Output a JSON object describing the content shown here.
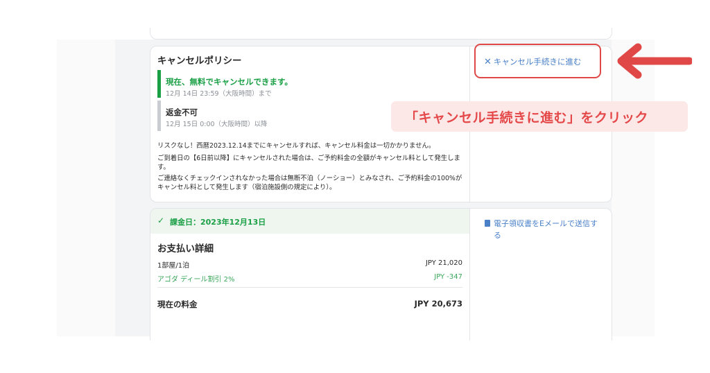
{
  "cancellation_policy": {
    "title": "キャンセルポリシー",
    "free_cancel_title": "現在、無料でキャンセルできます。",
    "free_cancel_until": "12月 14日 23:59（大阪時間）まで",
    "nonrefundable_title": "返金不可",
    "nonrefundable_from": "12月 15日 0:00（大阪時間）以降",
    "paragraph_1": "リスクなし！西暦2023.12.14までにキャンセルすれば、キャンセル料金は一切かかりません。",
    "paragraph_2": "ご到着日の【6日前以降】にキャンセルされた場合は、ご予約料金の全額がキャンセル料として発生します。",
    "paragraph_3": "ご連絡なくチェックインされなかった場合は無断不泊（ノーショー）とみなされ、ご予約料金の100%がキャンセル料として発生します（宿泊施設側の規定により）。",
    "cancel_link_icon": "close-icon",
    "cancel_link": "キャンセル手続きに進む"
  },
  "annotation": {
    "callout_text": "「キャンセル手続きに進む」をクリック",
    "highlight_color": "#e04848",
    "arrow_icon": "left-arrow-icon"
  },
  "payment": {
    "charge_icon": "check-icon",
    "charge_date": "課金日：2023年12月13日",
    "title": "お支払い詳細",
    "rows": [
      {
        "label": "1部屋/1泊",
        "amount": "JPY 21,020"
      },
      {
        "label": "アゴダ ディール割引 2%",
        "amount": "JPY -347"
      }
    ],
    "total_label": "現在の料金",
    "total_amount": "JPY 20,673",
    "receipt_icon": "document-icon",
    "receipt_link": "電子領収書をEメールで送信する"
  },
  "colors": {
    "green": "#1a9f45",
    "link_blue": "#4a80c8",
    "callout_bg": "#fde8e8",
    "callout_text": "#e44848"
  }
}
